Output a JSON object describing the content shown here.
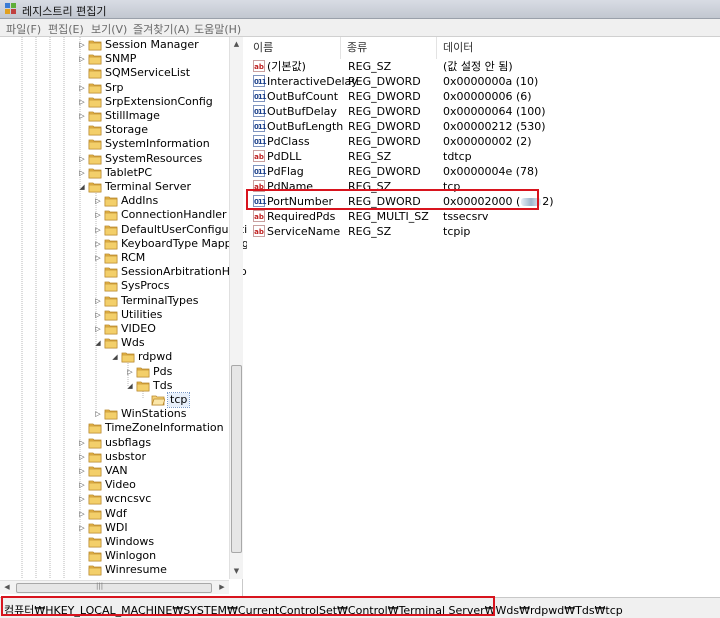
{
  "window": {
    "title": "레지스트리 편집기"
  },
  "menu": [
    "파일(F)",
    "편집(E)",
    "보기(V)",
    "즐겨찾기(A)",
    "도움말(H)"
  ],
  "tree": [
    {
      "label": "Session Manager",
      "level": 0,
      "expander": "collapsed"
    },
    {
      "label": "SNMP",
      "level": 0,
      "expander": "collapsed"
    },
    {
      "label": "SQMServiceList",
      "level": 0,
      "expander": "none"
    },
    {
      "label": "Srp",
      "level": 0,
      "expander": "collapsed"
    },
    {
      "label": "SrpExtensionConfig",
      "level": 0,
      "expander": "collapsed"
    },
    {
      "label": "StillImage",
      "level": 0,
      "expander": "collapsed"
    },
    {
      "label": "Storage",
      "level": 0,
      "expander": "none"
    },
    {
      "label": "SystemInformation",
      "level": 0,
      "expander": "none"
    },
    {
      "label": "SystemResources",
      "level": 0,
      "expander": "collapsed"
    },
    {
      "label": "TabletPC",
      "level": 0,
      "expander": "collapsed"
    },
    {
      "label": "Terminal Server",
      "level": 0,
      "expander": "expanded"
    },
    {
      "label": "AddIns",
      "level": 1,
      "expander": "collapsed"
    },
    {
      "label": "ConnectionHandler",
      "level": 1,
      "expander": "collapsed"
    },
    {
      "label": "DefaultUserConfiguration",
      "level": 1,
      "expander": "collapsed"
    },
    {
      "label": "KeyboardType Mapping",
      "level": 1,
      "expander": "collapsed"
    },
    {
      "label": "RCM",
      "level": 1,
      "expander": "collapsed"
    },
    {
      "label": "SessionArbitrationHelper",
      "level": 1,
      "expander": "none"
    },
    {
      "label": "SysProcs",
      "level": 1,
      "expander": "none"
    },
    {
      "label": "TerminalTypes",
      "level": 1,
      "expander": "collapsed"
    },
    {
      "label": "Utilities",
      "level": 1,
      "expander": "collapsed"
    },
    {
      "label": "VIDEO",
      "level": 1,
      "expander": "collapsed"
    },
    {
      "label": "Wds",
      "level": 1,
      "expander": "expanded"
    },
    {
      "label": "rdpwd",
      "level": 2,
      "expander": "expanded"
    },
    {
      "label": "Pds",
      "level": 3,
      "expander": "collapsed"
    },
    {
      "label": "Tds",
      "level": 3,
      "expander": "expanded"
    },
    {
      "label": "tcp",
      "level": 4,
      "expander": "none",
      "selected": true
    },
    {
      "label": "WinStations",
      "level": 1,
      "expander": "collapsed"
    },
    {
      "label": "TimeZoneInformation",
      "level": 0,
      "expander": "none"
    },
    {
      "label": "usbflags",
      "level": 0,
      "expander": "collapsed"
    },
    {
      "label": "usbstor",
      "level": 0,
      "expander": "collapsed"
    },
    {
      "label": "VAN",
      "level": 0,
      "expander": "collapsed"
    },
    {
      "label": "Video",
      "level": 0,
      "expander": "collapsed"
    },
    {
      "label": "wcncsvc",
      "level": 0,
      "expander": "collapsed"
    },
    {
      "label": "Wdf",
      "level": 0,
      "expander": "collapsed"
    },
    {
      "label": "WDI",
      "level": 0,
      "expander": "collapsed"
    },
    {
      "label": "Windows",
      "level": 0,
      "expander": "none"
    },
    {
      "label": "Winlogon",
      "level": 0,
      "expander": "none"
    },
    {
      "label": "Winresume",
      "level": 0,
      "expander": "none"
    }
  ],
  "columns": {
    "name": "이름",
    "type": "종류",
    "data": "데이터"
  },
  "values": [
    {
      "icon": "string-value-icon",
      "kind": "sz",
      "name": "(기본값)",
      "type": "REG_SZ",
      "data": "(값 설정 안 됨)"
    },
    {
      "icon": "dword-value-icon",
      "kind": "dw",
      "name": "InteractiveDelay",
      "type": "REG_DWORD",
      "data": "0x0000000a (10)"
    },
    {
      "icon": "dword-value-icon",
      "kind": "dw",
      "name": "OutBufCount",
      "type": "REG_DWORD",
      "data": "0x00000006 (6)"
    },
    {
      "icon": "dword-value-icon",
      "kind": "dw",
      "name": "OutBufDelay",
      "type": "REG_DWORD",
      "data": "0x00000064 (100)"
    },
    {
      "icon": "dword-value-icon",
      "kind": "dw",
      "name": "OutBufLength",
      "type": "REG_DWORD",
      "data": "0x00000212 (530)"
    },
    {
      "icon": "dword-value-icon",
      "kind": "dw",
      "name": "PdClass",
      "type": "REG_DWORD",
      "data": "0x00000002 (2)"
    },
    {
      "icon": "string-value-icon",
      "kind": "sz",
      "name": "PdDLL",
      "type": "REG_SZ",
      "data": "tdtcp"
    },
    {
      "icon": "dword-value-icon",
      "kind": "dw",
      "name": "PdFlag",
      "type": "REG_DWORD",
      "data": "0x0000004e (78)"
    },
    {
      "icon": "string-value-icon",
      "kind": "sz",
      "name": "PdName",
      "type": "REG_SZ",
      "data": "tcp"
    },
    {
      "icon": "dword-value-icon",
      "kind": "dw",
      "name": "PortNumber",
      "type": "REG_DWORD",
      "data": "0x00002000 (",
      "data_suffix": "2)",
      "highlighted": true
    },
    {
      "icon": "string-value-icon",
      "kind": "sz",
      "name": "RequiredPds",
      "type": "REG_MULTI_SZ",
      "data": "tssecsrv"
    },
    {
      "icon": "string-value-icon",
      "kind": "sz",
      "name": "ServiceName",
      "type": "REG_SZ",
      "data": "tcpip"
    }
  ],
  "statusbar": {
    "path": "컴퓨터₩HKEY_LOCAL_MACHINE₩SYSTEM₩CurrentControlSet₩Control₩Terminal Server₩Wds₩rdpwd₩Tds₩tcp"
  },
  "colors": {
    "highlight_border": "#d8141e",
    "folder": "#e8b84a"
  },
  "icons": {
    "app": "registry-editor-icon",
    "folder": "folder-icon",
    "scroll_up": "scroll-up-arrow-icon",
    "scroll_down": "scroll-down-arrow-icon"
  }
}
